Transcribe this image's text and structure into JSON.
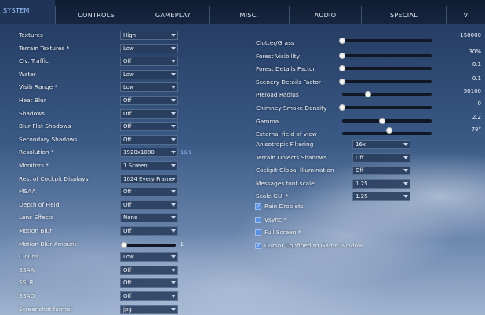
{
  "tabs": [
    {
      "label": "SYSTEM",
      "active": true
    },
    {
      "label": "CONTROLS"
    },
    {
      "label": "GAMEPLAY"
    },
    {
      "label": "MISC."
    },
    {
      "label": "AUDIO"
    },
    {
      "label": "SPECIAL"
    },
    {
      "label": "V"
    }
  ],
  "left": [
    {
      "label": "Textures",
      "value": "High"
    },
    {
      "label": "Terrain Textures *",
      "value": "Low"
    },
    {
      "label": "Civ. Traffic",
      "value": "Off"
    },
    {
      "label": "Water",
      "value": "Low"
    },
    {
      "label": "Visib Range *",
      "value": "Low"
    },
    {
      "label": "Heat Blur",
      "value": "Off"
    },
    {
      "label": "Shadows",
      "value": "Off"
    },
    {
      "label": "Blur Flat Shadows",
      "value": "Off"
    },
    {
      "label": "Secondary Shadows",
      "value": "Off"
    },
    {
      "label": "Resolution *",
      "value": "1920x1080",
      "extra": "16:9"
    },
    {
      "label": "Monitors *",
      "value": "1 Screen"
    },
    {
      "label": "Res. of Cockpit Displays",
      "value": "1024 Every Frame"
    },
    {
      "label": "MSAA",
      "value": "Off"
    },
    {
      "label": "Depth of Field",
      "value": "Off"
    },
    {
      "label": "Lens Effects",
      "value": "None"
    },
    {
      "label": "Motion Blur",
      "value": "Off"
    },
    {
      "label": "Motion Blur Amount",
      "slider": 0,
      "value": "1"
    },
    {
      "label": "Clouds",
      "value": "Low"
    },
    {
      "label": "SSAA",
      "value": "Off"
    },
    {
      "label": "SSLR",
      "value": "Off"
    },
    {
      "label": "SSAO",
      "value": "Off"
    },
    {
      "label": "Screenshot format",
      "value": "jpg"
    }
  ],
  "right_sliders": [
    {
      "label": "Clutter/Grass",
      "value": "-150000",
      "level": 0
    },
    {
      "label": "Forest Visibility",
      "value": "30%",
      "level": 0
    },
    {
      "label": "Forest Details Factor",
      "value": "0.1",
      "level": 0
    },
    {
      "label": "Scenery Details Factor",
      "value": "0.1",
      "level": 0
    },
    {
      "label": "Preload Radius",
      "value": "50100",
      "level": 0.29
    },
    {
      "label": "Chimney Smoke Density",
      "value": "0",
      "level": 0
    },
    {
      "label": "Gamma",
      "value": "2.2",
      "level": 0.45
    },
    {
      "label": "External field of view",
      "value": "78°",
      "level": 0.53
    }
  ],
  "right_dropdowns": [
    {
      "label": "Anisotropic Filtering",
      "value": "16x"
    },
    {
      "label": "Terrain Objects Shadows",
      "value": "Off"
    },
    {
      "label": "Cockpit Global Illumination",
      "value": "Off"
    },
    {
      "label": "Messages font scale",
      "value": "1.25"
    },
    {
      "label": "Scale GUI *",
      "value": "1.25"
    }
  ],
  "checkboxes": [
    {
      "label": "Rain Droplets",
      "checked": true
    },
    {
      "label": "Vsync *",
      "checked": false
    },
    {
      "label": "Full Screen *",
      "checked": false
    },
    {
      "label": "Cursor Confined to Game Window",
      "checked": true
    }
  ],
  "colors": {
    "accent": "#9fc4ff",
    "checkbox": "#5b8fe0"
  }
}
